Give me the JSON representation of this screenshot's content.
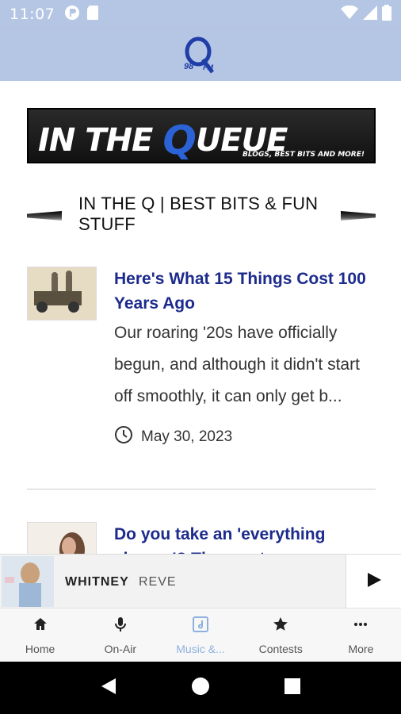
{
  "status_bar": {
    "time": "11:07",
    "left_icons": [
      "p-circle-icon",
      "sd-card-icon"
    ],
    "right_icons": [
      "wifi-icon",
      "cell-signal-icon",
      "battery-icon"
    ]
  },
  "header": {
    "logo_text": "Q",
    "logo_sub": "98",
    "logo_fm": "FM"
  },
  "banner": {
    "title_part1": "IN THE",
    "title_q": "Q",
    "title_part2": "UEUE",
    "tagline": "BLOGS, BEST BITS AND MORE!"
  },
  "section": {
    "title": "IN THE Q | BEST BITS & FUN STUFF"
  },
  "articles": [
    {
      "title": "Here's What 15 Things Cost 100 Years Ago",
      "excerpt": "Our roaring '20s have officially begun, and although it didn't start off smoothly, it can only get b...",
      "date": "May 30, 2023"
    },
    {
      "title": "Do you take an 'everything shower'? The creator..."
    }
  ],
  "now_playing": {
    "title": "WHITNEY",
    "subtitle": "REVE"
  },
  "bottom_nav": {
    "items": [
      {
        "label": "Home",
        "icon": "home-icon"
      },
      {
        "label": "On-Air",
        "icon": "microphone-icon"
      },
      {
        "label": "Music &...",
        "icon": "music-icon",
        "active": true
      },
      {
        "label": "Contests",
        "icon": "star-icon"
      },
      {
        "label": "More",
        "icon": "more-icon"
      }
    ]
  },
  "colors": {
    "header_bg": "#b5c6e4",
    "link_blue": "#1c2b8c",
    "active_tab": "#8fb1de",
    "logo_blue": "#1f3ea8"
  }
}
